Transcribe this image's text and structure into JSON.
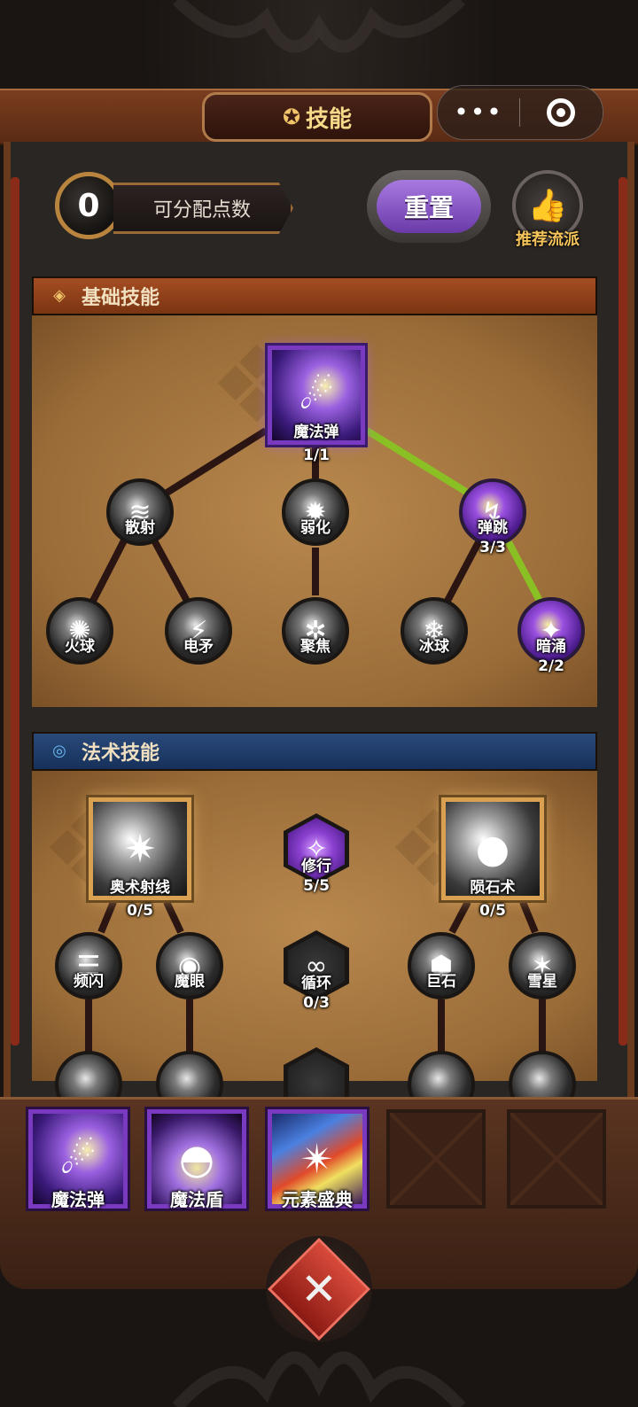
{
  "header": {
    "title": "技能",
    "title_icon": "skill-emblem-icon",
    "capsule_more": "•••",
    "capsule_close_icon": "target-circle-icon"
  },
  "points": {
    "value": "0",
    "label": "可分配点数"
  },
  "reset_label": "重置",
  "recommend_label": "推荐流派",
  "sections": {
    "basic": {
      "title": "基础技能"
    },
    "spell": {
      "title": "法术技能"
    }
  },
  "basic_tree": {
    "root": {
      "name": "魔法弹",
      "level": "1/1"
    },
    "tier2": [
      {
        "name": "散射",
        "level": ""
      },
      {
        "name": "弱化",
        "level": ""
      },
      {
        "name": "弹跳",
        "level": "3/3"
      }
    ],
    "tier3": [
      {
        "name": "火球",
        "level": ""
      },
      {
        "name": "电矛",
        "level": ""
      },
      {
        "name": "聚焦",
        "level": ""
      },
      {
        "name": "冰球",
        "level": ""
      },
      {
        "name": "暗涌",
        "level": "2/2"
      }
    ]
  },
  "spell_tree": {
    "left": {
      "name": "奥术射线",
      "level": "0/5"
    },
    "middle_top": {
      "name": "修行",
      "level": "5/5"
    },
    "right": {
      "name": "陨石术",
      "level": "0/5"
    },
    "middle_hex": {
      "name": "循环",
      "level": "0/3"
    },
    "tier2": [
      {
        "name": "频闪"
      },
      {
        "name": "魔眼"
      },
      {
        "name": "巨石"
      },
      {
        "name": "雪星"
      }
    ]
  },
  "equipped": [
    {
      "name": "魔法弹"
    },
    {
      "name": "魔法盾"
    },
    {
      "name": "元素盛典"
    }
  ],
  "colors": {
    "accent_purple": "#7a3ac0",
    "active_line": "#8ac024",
    "inactive_line": "#2a1512",
    "gold": "#f2c46a"
  }
}
